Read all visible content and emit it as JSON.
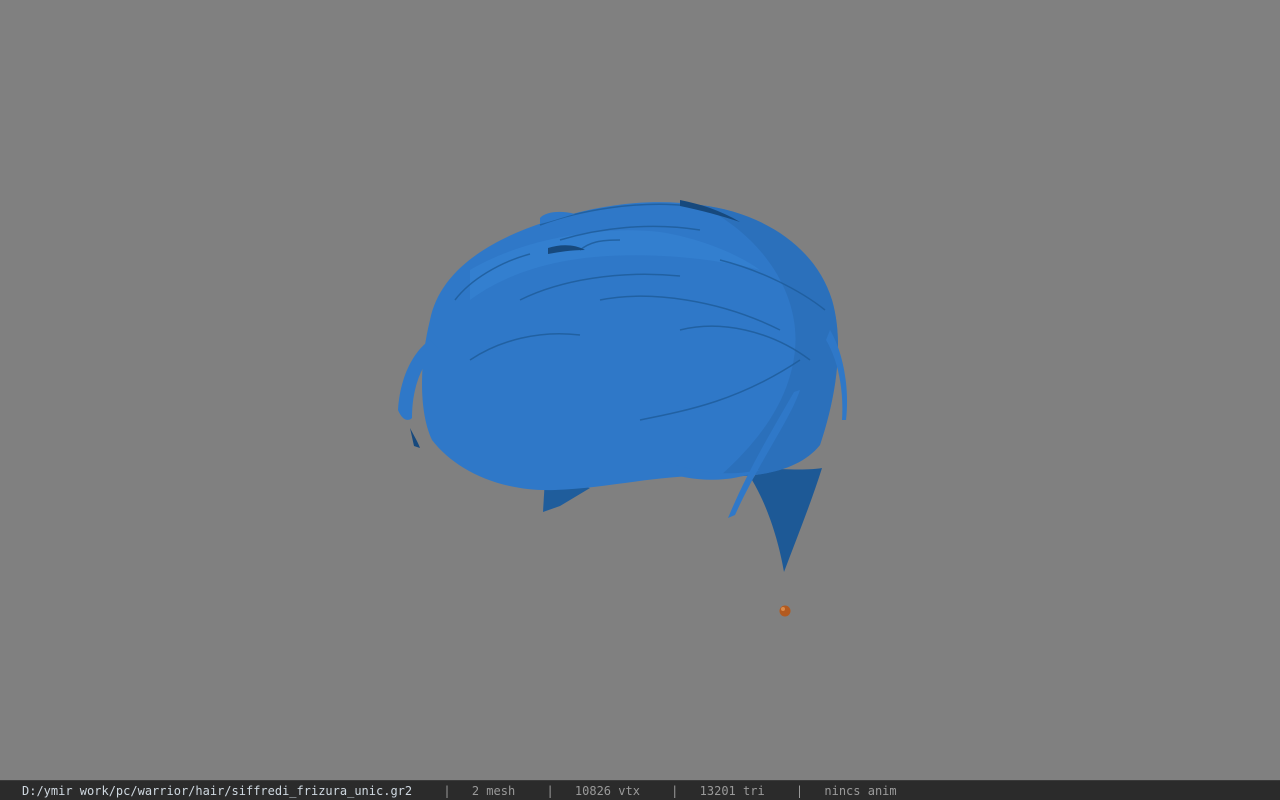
{
  "viewport": {
    "background": "#808080",
    "model_color": "#2f78c8",
    "model_shadow": "#1d5996",
    "marker_color": "#b35a1f",
    "model_description_icon": "hair-mesh-icon"
  },
  "status": {
    "path": "D:/ymir work/pc/warrior/hair/siffredi_frizura_unic.gr2",
    "separator": "|",
    "mesh": "2 mesh",
    "vtx": "10826 vtx",
    "tri": "13201 tri",
    "anim": "nincs anim"
  }
}
